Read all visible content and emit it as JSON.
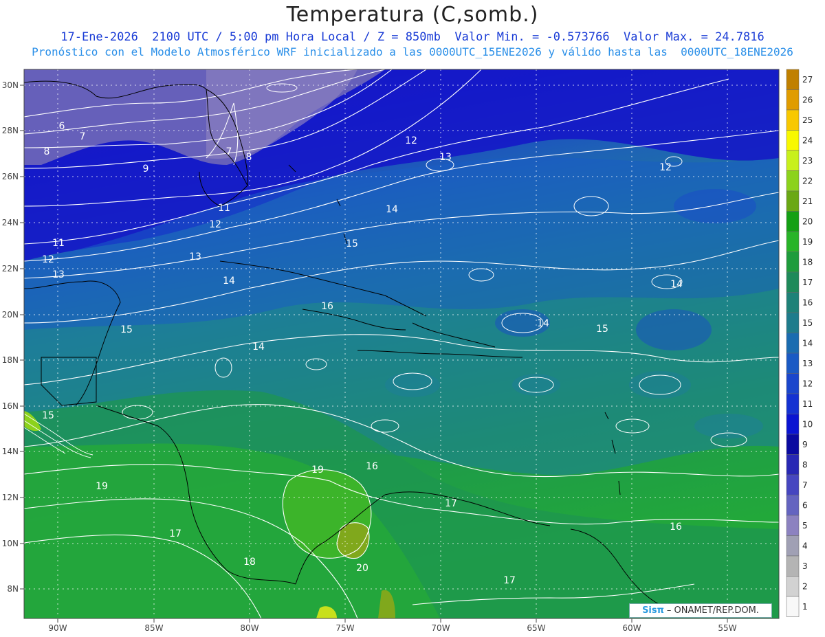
{
  "header": {
    "title": "Temperatura (C,somb.)",
    "line1": "17-Ene-2026  2100 UTC / 5:00 pm Hora Local / Z = 850mb  Valor Min. = -0.573766  Valor Max. = 24.7816",
    "line2": "Pronóstico con el Modelo Atmosférico WRF inicializado a las 0000UTC_15ENE2026 y válido hasta las  0000UTC_18ENE2026"
  },
  "map": {
    "lat_labels": [
      "30N",
      "28N",
      "26N",
      "24N",
      "22N",
      "20N",
      "18N",
      "16N",
      "14N",
      "12N",
      "10N",
      "8N"
    ],
    "lon_labels": [
      "90W",
      "85W",
      "80W",
      "75W",
      "70W",
      "65W",
      "60W",
      "55W"
    ],
    "contour_labels": [
      "6",
      "7",
      "8",
      "9",
      "11",
      "12",
      "13",
      "14",
      "15",
      "16",
      "17",
      "18",
      "19",
      "20",
      "12",
      "13",
      "14",
      "15",
      "14",
      "15",
      "16",
      "17",
      "12",
      "14",
      "7",
      "8",
      "11",
      "12",
      "13",
      "14",
      "15",
      "16",
      "19",
      "17"
    ],
    "field_colors": {
      "northwest_cold": "#6f68b8",
      "cold_band": "#1414c8",
      "mid_blue": "#1a5cc4",
      "teal": "#1e7e9a",
      "green_teal": "#1e8c6a",
      "green": "#22a03a",
      "light_green": "#4cb22c",
      "warm_spot": "#80a81c"
    }
  },
  "colorbar": {
    "labels": [
      "27",
      "26",
      "25",
      "24",
      "23",
      "22",
      "21",
      "20",
      "19",
      "18",
      "17",
      "16",
      "15",
      "14",
      "13",
      "12",
      "11",
      "10",
      "9",
      "8",
      "7",
      "6",
      "5",
      "4",
      "3",
      "2",
      "1"
    ],
    "colors": [
      "#c08000",
      "#e09c00",
      "#f8c800",
      "#f8f800",
      "#c8f01c",
      "#8cd21c",
      "#6aa814",
      "#14a014",
      "#28b428",
      "#1e9c3c",
      "#1e8a5a",
      "#1e8278",
      "#1e7c8c",
      "#1a6cb0",
      "#1a5ac4",
      "#1a46cc",
      "#1432d2",
      "#0a14d2",
      "#0a0aa0",
      "#2828b4",
      "#4646c0",
      "#6464c0",
      "#8c82c0",
      "#a0a0b4",
      "#b4b4b4",
      "#d2d2d2",
      "#f8f8f8"
    ]
  },
  "credit": {
    "logo": "Sisπ",
    "text": "– ONAMET/REP.DOM."
  }
}
